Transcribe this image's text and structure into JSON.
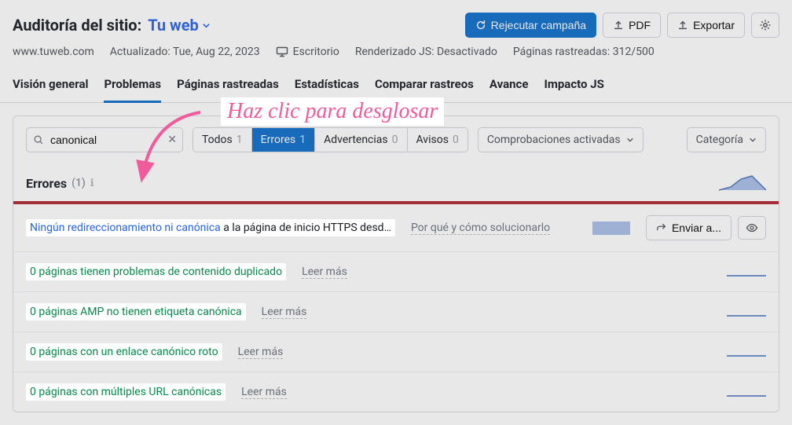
{
  "header": {
    "title_label": "Auditoría del sitio:",
    "domain_label": "Tu web",
    "rerun": "Rejecutar campaña",
    "pdf": "PDF",
    "export": "Exportar"
  },
  "meta": {
    "url": "www.tuweb.com",
    "updated": "Actualizado: Tue, Aug 22, 2023",
    "device": "Escritorio",
    "js": "Renderizado JS: Desactivado",
    "crawled": "Páginas rastreadas: 312/500"
  },
  "tabs": {
    "overview": "Visión general",
    "issues": "Problemas",
    "crawled": "Páginas rastreadas",
    "stats": "Estadísticas",
    "compare": "Comparar rastreos",
    "progress": "Avance",
    "jsimpact": "Impacto JS"
  },
  "filters": {
    "search_value": "canonical",
    "all": "Todos",
    "all_count": "1",
    "errors": "Errores",
    "errors_count": "1",
    "warnings": "Advertencias",
    "warnings_count": "0",
    "notices": "Avisos",
    "notices_count": "0",
    "checks": "Comprobaciones activadas",
    "category": "Categoría"
  },
  "section": {
    "title": "Errores",
    "count": "(1)"
  },
  "issues": [
    {
      "pre": "Ningún redireccionamiento ni canónica",
      "post": " a la página de inicio HTTPS desd…",
      "sub": "Por qué y cómo solucionarlo",
      "send": "Enviar a...",
      "type": "primary"
    },
    {
      "pre": "0 páginas tienen problemas de contenido duplicado",
      "sub": "Leer más",
      "type": "zero"
    },
    {
      "pre": "0 páginas AMP no tienen etiqueta canónica",
      "sub": "Leer más",
      "type": "zero"
    },
    {
      "pre": "0 páginas con un enlace canónico roto",
      "sub": "Leer más",
      "type": "zero"
    },
    {
      "pre": "0 páginas con múltiples URL canónicas",
      "sub": "Leer más",
      "type": "zero"
    }
  ],
  "callout": "Haz clic para desglosar"
}
